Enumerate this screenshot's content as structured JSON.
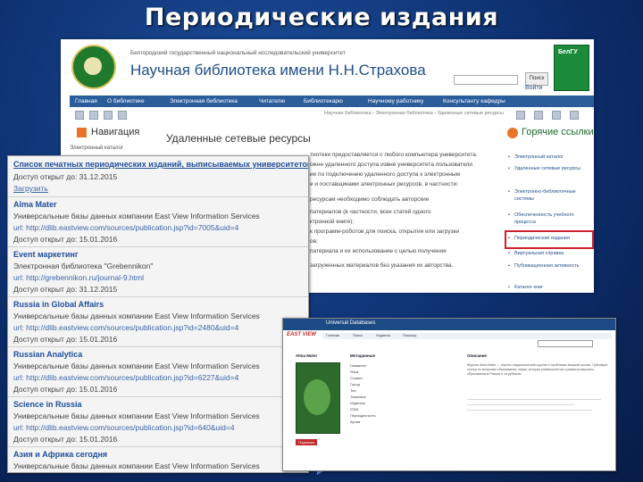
{
  "slide": {
    "title": "Периодические издания"
  },
  "site": {
    "university_line": "Белгородский государственный национальный исследовательский университет",
    "library_name": "Научная библиотека имени Н.Н.Страхова",
    "search_button": "Поиск",
    "login_link": "Войти",
    "right_logo_text": "БелГУ",
    "nav_items": [
      "Главная",
      "О библиотеке",
      "Электронная библиотека",
      "Читателю",
      "Библиотекарю",
      "Научному работнику",
      "Консультанту кафедры"
    ],
    "breadcrumbs": "Научная библиотека › Электронная библиотека › Удаленные сетевые ресурсы",
    "nav_panel_title": "Навигация",
    "nav_panel_item": "Электронный каталог",
    "main_title": "Удаленные сетевые ресурсы",
    "main_lines": [
      "тиотеки предоставляется с любого компьютера университета.",
      "ожне удаленного доступа извне университета пользователи",
      "ие по подключению удаленного доступа к электронным",
      "е и поставщиками электронных ресурсов, в частности:",
      "ресурсам необходимо соблюдать авторские",
      "патериалов (в частности, всех статей одного",
      "ктронной книге);",
      "к программ-роботов для поиска, открытия или загрузки",
      "ов;",
      "патериала и их использование с целью получения",
      "загруженных материалов без указания их авторства."
    ],
    "side_title": "Горячие ссылки",
    "side_items": [
      "Электронный каталог",
      "Удаленные сетевые ресурсы",
      "Электронно-библиотечные системы",
      "Обеспеченность учебного процесса",
      "Периодические издания",
      "Виртуальная справка",
      "Публикационная активность",
      "Каталог книг"
    ]
  },
  "periodicals": {
    "first_title": "Список печатных периодических изданий, выписываемых университетом",
    "first_access": "Доступ открыт до: 31.12.2015",
    "download_link": "Загрузить",
    "entries": [
      {
        "title": "Alma Mater",
        "provider": "Универсальные базы данных компании East View Information Services",
        "url": "url: http://dlib.eastview.com/sources/publication.jsp?id=7005&uid=4",
        "access": "Доступ открыт до: 15.01.2016"
      },
      {
        "title": "Event маркетинг",
        "provider": "Электронная библиотека \"Grebennikon\"",
        "url": "url: http://grebennikon.ru/journal-9.html",
        "access": "Доступ открыт до: 31.12.2015"
      },
      {
        "title": "Russia in Global Affairs",
        "provider": "Универсальные базы данных компании East View Information Services",
        "url": "url: http://dlib.eastview.com/sources/publication.jsp?id=2480&uid=4",
        "access": "Доступ открыт до: 15.01.2016"
      },
      {
        "title": "Russian Analytica",
        "provider": "Универсальные базы данных компании East View Information Services",
        "url": "url: http://dlib.eastview.com/sources/publication.jsp?id=6227&uid=4",
        "access": "Доступ открыт до: 15.01.2016"
      },
      {
        "title": "Science in Russia",
        "provider": "Универсальные базы данных компании East View Information Services",
        "url": "url: http://dlib.eastview.com/sources/publication.jsp?id=640&uid=4",
        "access": "Доступ открыт до: 15.01.2016"
      },
      {
        "title": "Азия и Африка сегодня",
        "provider": "Универсальные базы данных компании East View Information Services",
        "url": "",
        "access": ""
      }
    ]
  },
  "eastview": {
    "top_tab": "Universal Databases",
    "logo_text": "EAST VIEW",
    "nav_links": [
      "Главная",
      "Поиск",
      "Издания",
      "Помощь"
    ],
    "col_headers": [
      "Alma Mater",
      "Метаданные",
      "Описание"
    ],
    "button": "Подписка",
    "fields": [
      "Название",
      "Язык",
      "Страна",
      "Город",
      "Тип",
      "Тематика",
      "Издатель",
      "ISSN",
      "Периодичность",
      "Архив"
    ],
    "description": "Журнал Alma Mater — научно-педагогический журнал о проблемах высшей школы. Публикует статьи по вопросам образования, науки, истории университетов и развития высшего образования в России и за рубежом."
  },
  "colors": {
    "accent": "#2b5d9b",
    "link": "#1f4f9a",
    "highlight": "#d0202a"
  }
}
